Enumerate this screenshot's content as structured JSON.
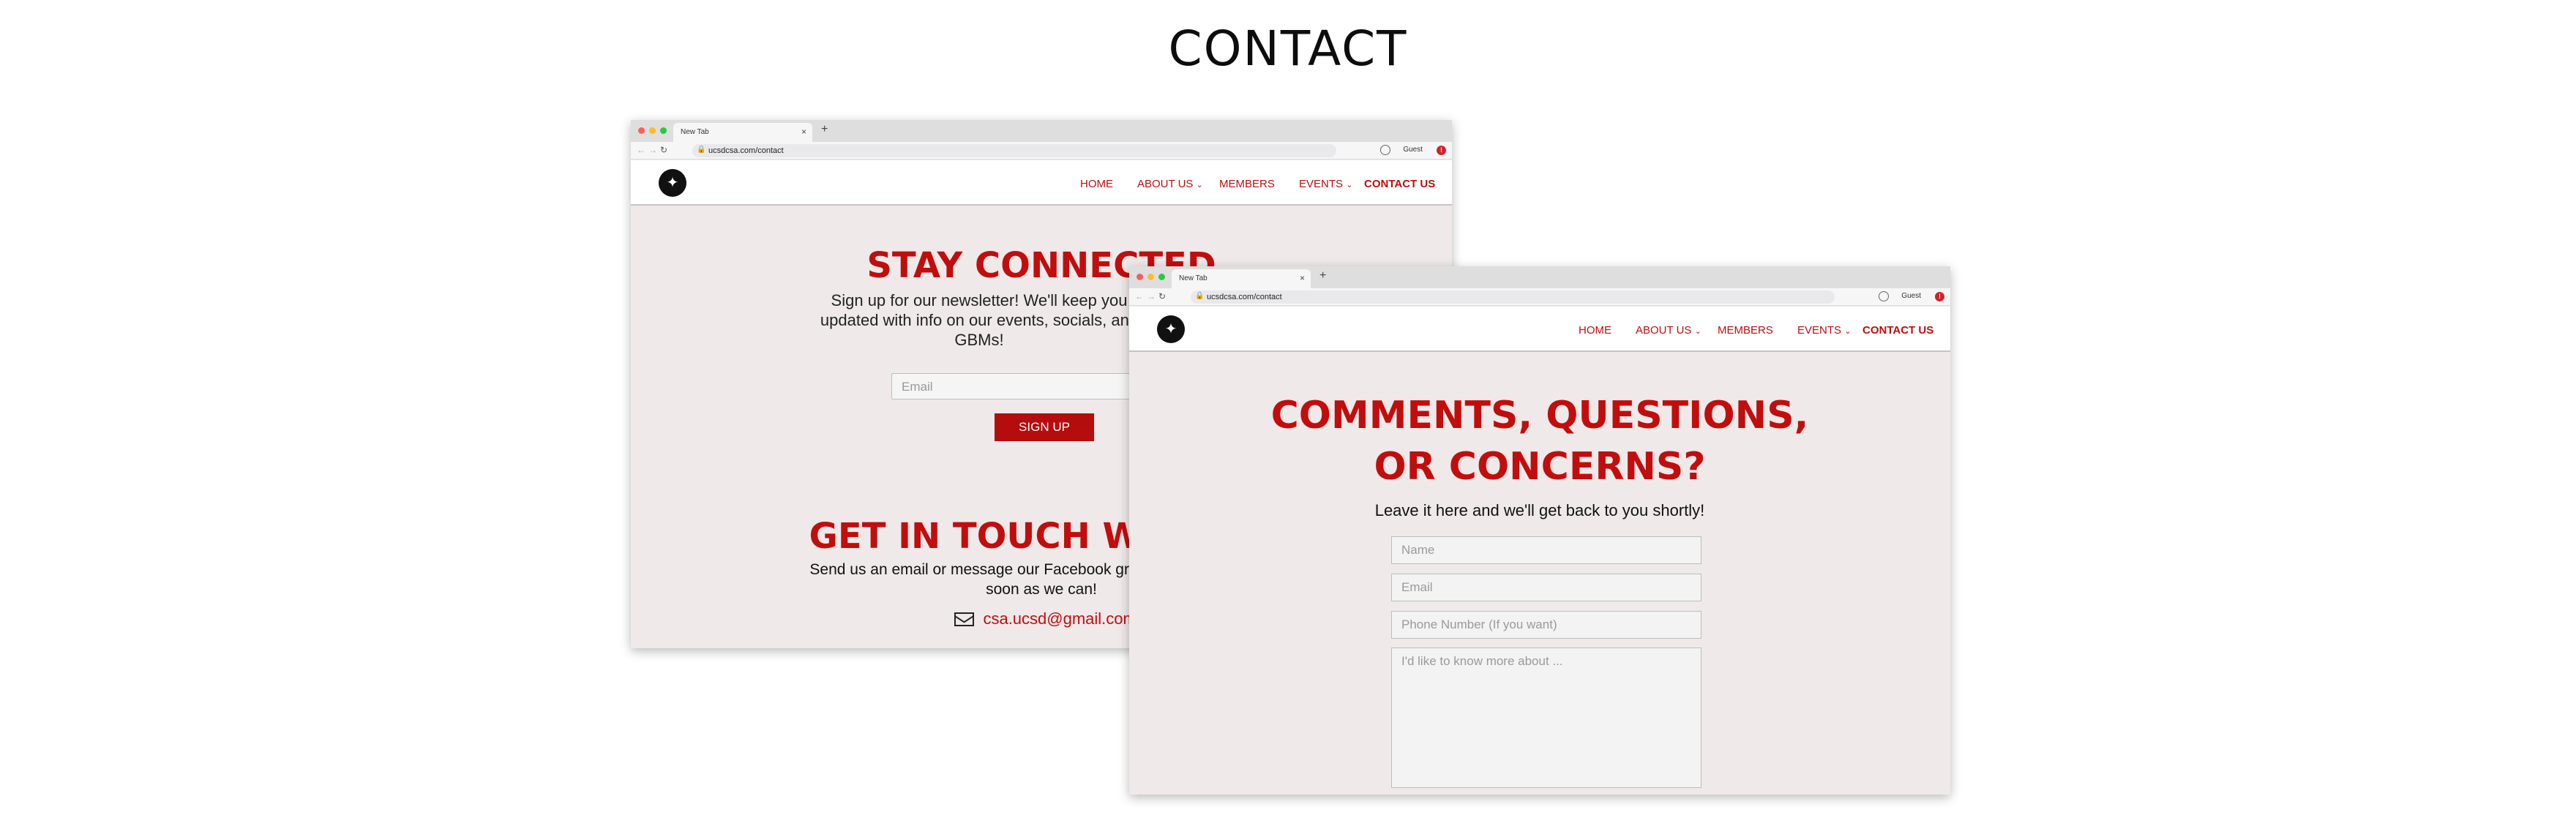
{
  "page": {
    "title": "CONTACT"
  },
  "browser": {
    "tab_title": "New Tab",
    "tab_close": "×",
    "new_tab": "+",
    "url": "ucsdcsa.com/contact",
    "guest": "Guest"
  },
  "nav": {
    "home": "HOME",
    "about": "ABOUT US",
    "members": "MEMBERS",
    "events": "EVENTS",
    "contact": "CONTACT US"
  },
  "newsletter": {
    "title": "STAY CONNECTED",
    "text": "Sign up for our newsletter! We'll keep you updated with info on our events, socials, and GBMs!",
    "email_placeholder": "Email",
    "button": "SIGN UP"
  },
  "touch": {
    "title": "GET IN TOUCH WITH US",
    "text": "Send us an email or message our Facebook group, we'll respond as soon as we can!",
    "email": "csa.ucsd@gmail.com"
  },
  "contact_form": {
    "title_line1": "COMMENTS, QUESTIONS,",
    "title_line2": "OR CONCERNS?",
    "subtitle": "Leave it here and we'll get back to you shortly!",
    "name_placeholder": "Name",
    "email_placeholder": "Email",
    "phone_placeholder": "Phone Number (If you want)",
    "message_placeholder": "I'd like to know more about ..."
  },
  "colors": {
    "accent": "#c20d0d",
    "page_bg": "#efe9e9",
    "button": "#b50d0d"
  },
  "icons": [
    "back-icon",
    "forward-icon",
    "reload-icon",
    "lock-icon",
    "profile-icon",
    "alert-icon",
    "chevron-down-icon",
    "mail-icon",
    "logo"
  ]
}
